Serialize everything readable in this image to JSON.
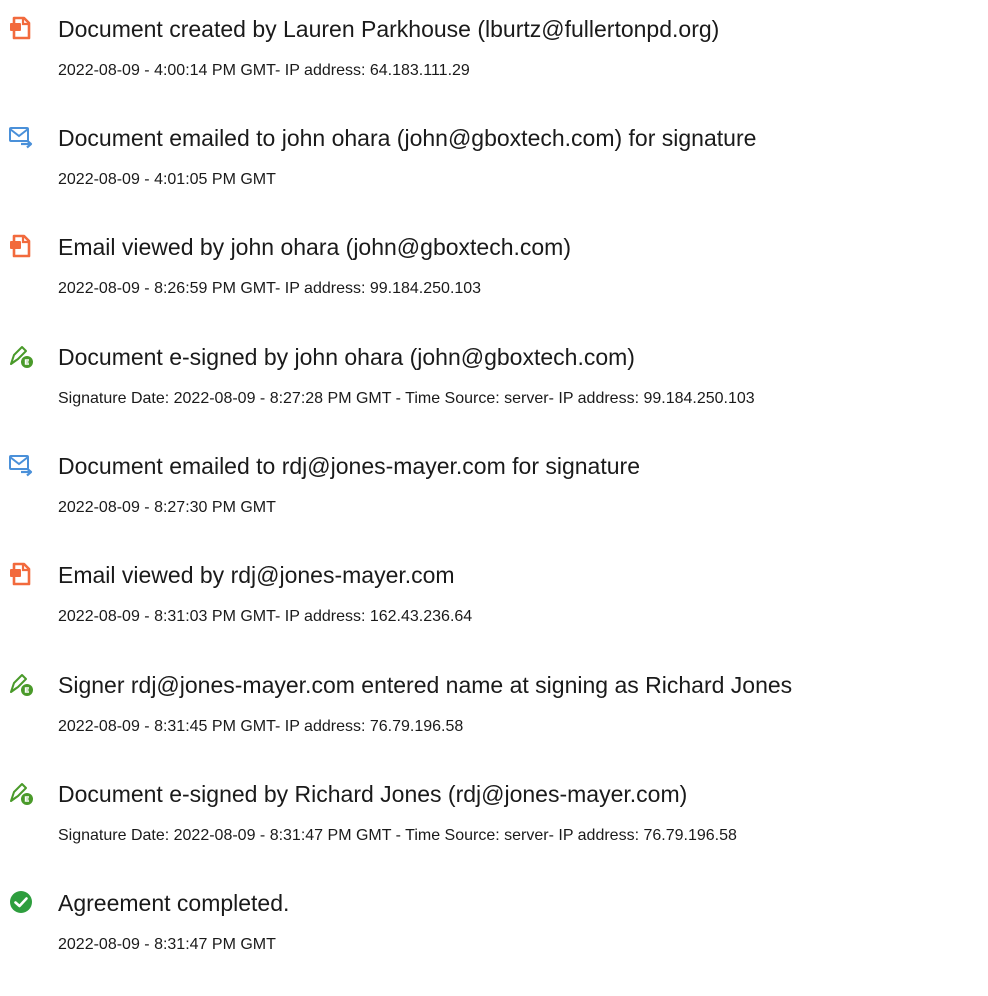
{
  "events": [
    {
      "icon": "document-created-icon",
      "title": "Document created by Lauren Parkhouse (lburtz@fullertonpd.org)",
      "detail": "2022-08-09 - 4:00:14 PM GMT- IP address: 64.183.111.29"
    },
    {
      "icon": "email-sent-icon",
      "title": "Document emailed to john ohara (john@gboxtech.com) for signature",
      "detail": "2022-08-09 - 4:01:05 PM GMT"
    },
    {
      "icon": "document-viewed-icon",
      "title": "Email viewed by john ohara (john@gboxtech.com)",
      "detail": "2022-08-09 - 8:26:59 PM GMT- IP address: 99.184.250.103"
    },
    {
      "icon": "e-sign-pen-icon",
      "title": "Document e-signed by john ohara (john@gboxtech.com)",
      "detail": "Signature Date: 2022-08-09 - 8:27:28 PM GMT - Time Source: server- IP address: 99.184.250.103"
    },
    {
      "icon": "email-sent-icon",
      "title": "Document emailed to rdj@jones-mayer.com for signature",
      "detail": "2022-08-09 - 8:27:30 PM GMT"
    },
    {
      "icon": "document-viewed-icon",
      "title": "Email viewed by rdj@jones-mayer.com",
      "detail": "2022-08-09 - 8:31:03 PM GMT- IP address: 162.43.236.64"
    },
    {
      "icon": "e-sign-pen-icon",
      "title": "Signer rdj@jones-mayer.com entered name at signing as Richard Jones",
      "detail": "2022-08-09 - 8:31:45 PM GMT- IP address: 76.79.196.58"
    },
    {
      "icon": "e-sign-pen-icon",
      "title": "Document e-signed by Richard Jones (rdj@jones-mayer.com)",
      "detail": "Signature Date: 2022-08-09 - 8:31:47 PM GMT - Time Source: server- IP address: 76.79.196.58"
    },
    {
      "icon": "checkmark-circle-icon",
      "title": "Agreement completed.",
      "detail": "2022-08-09 - 8:31:47 PM GMT"
    }
  ],
  "colors": {
    "document_icon": "#f26a3d",
    "email_icon": "#4a90d9",
    "pen_icon": "#4a9a2a",
    "complete_icon": "#2e9e3e",
    "text": "#1a1a1a"
  }
}
